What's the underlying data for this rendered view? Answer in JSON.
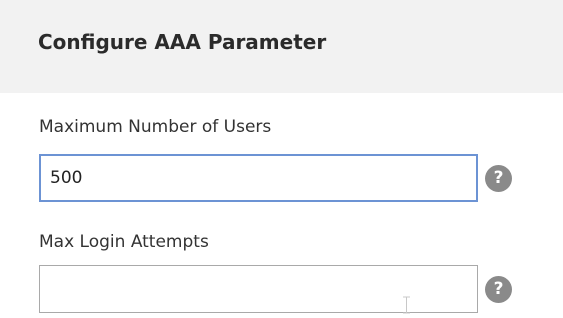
{
  "panel": {
    "title": "Configure AAA Parameter"
  },
  "fields": [
    {
      "label": "Maximum Number of Users",
      "value": "500",
      "help_icon": "question-mark-icon"
    },
    {
      "label": "Max Login Attempts",
      "value": "",
      "help_icon": "question-mark-icon"
    }
  ],
  "help_glyph": "?",
  "colors": {
    "header_bg": "#f2f2f2",
    "focus_border": "#6c93d4",
    "help_icon_bg": "#8a8a8a"
  }
}
